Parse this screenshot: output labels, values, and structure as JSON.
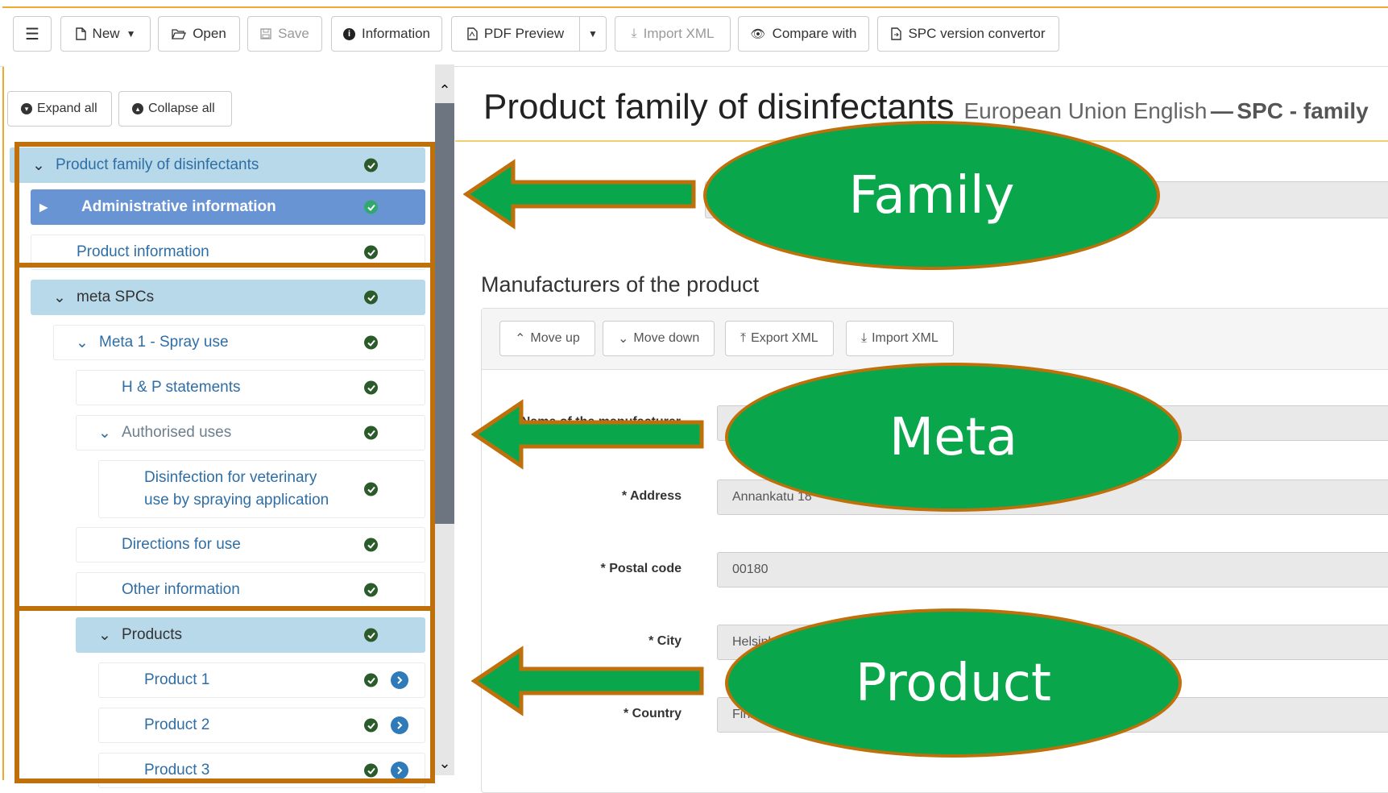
{
  "toolbar": {
    "menu_icon": "hamburger-icon",
    "new_label": "New",
    "open_label": "Open",
    "save_label": "Save",
    "information_label": "Information",
    "pdf_preview_label": "PDF Preview",
    "import_xml_label": "Import XML",
    "compare_label": "Compare with",
    "spc_convertor_label": "SPC version convertor"
  },
  "sidebar": {
    "expand_all": "Expand all",
    "collapse_all": "Collapse all",
    "tree": {
      "family": "Product family of disinfectants",
      "admin": "Administrative information",
      "product_info": "Product information",
      "meta_spcs": "meta SPCs",
      "meta1": "Meta 1 - Spray use",
      "hp": "H & P statements",
      "auth_uses": "Authorised uses",
      "disinfection_l1": "Disinfection for veterinary",
      "disinfection_l2": "use by spraying application",
      "directions": "Directions for use",
      "other_info": "Other information",
      "products": "Products",
      "product1": "Product 1",
      "product2": "Product 2",
      "product3": "Product 3"
    }
  },
  "main": {
    "title": "Product family of disinfectants",
    "language": "European Union English",
    "dash": "—",
    "spc": "SPC - family",
    "section_title": "Manufacturers of the product",
    "panel_buttons": {
      "move_up": "Move up",
      "move_down": "Move down",
      "export_xml": "Export XML",
      "import_xml": "Import XML"
    },
    "fields": {
      "name_label": "* Name of the manufacturer",
      "address_label": "* Address",
      "address_value": "Annankatu 18",
      "postal_label": "* Postal code",
      "postal_value": "00180",
      "city_label": "* City",
      "city_value": "Helsinki",
      "country_label": "* Country",
      "country_value": "Finland"
    }
  },
  "annotations": {
    "family": "Family",
    "meta": "Meta",
    "product": "Product"
  },
  "colors": {
    "accent_orange": "#c0700a",
    "annotation_green": "#0aa64b",
    "active_blue": "#6894d4",
    "highlight_blue": "#b8d9ea"
  }
}
